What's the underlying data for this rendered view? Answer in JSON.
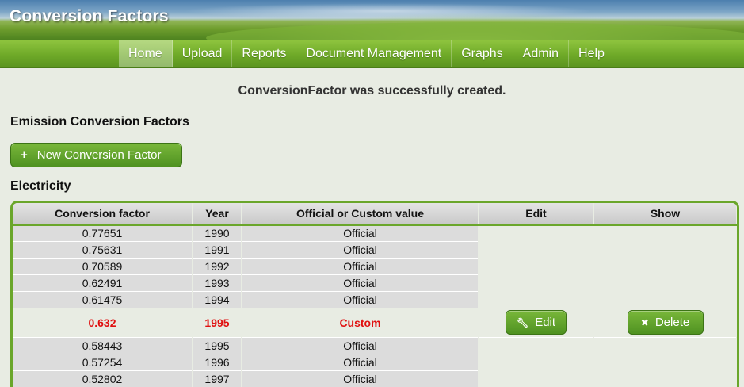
{
  "app": {
    "title": "Conversion Factors"
  },
  "nav": {
    "items": [
      {
        "label": "Home"
      },
      {
        "label": "Upload"
      },
      {
        "label": "Reports"
      },
      {
        "label": "Document Management"
      },
      {
        "label": "Graphs"
      },
      {
        "label": "Admin"
      },
      {
        "label": "Help"
      }
    ],
    "active": "Home"
  },
  "flash": "ConversionFactor was successfully created.",
  "section_title": "Emission Conversion Factors",
  "new_button": {
    "label": "New Conversion Factor",
    "icon": "plus-icon"
  },
  "group_title": "Electricity",
  "table": {
    "headers": [
      "Conversion factor",
      "Year",
      "Official or Custom value",
      "Edit",
      "Show"
    ],
    "rows_before": [
      {
        "factor": "0.77651",
        "year": "1990",
        "type": "Official"
      },
      {
        "factor": "0.75631",
        "year": "1991",
        "type": "Official"
      },
      {
        "factor": "0.70589",
        "year": "1992",
        "type": "Official"
      },
      {
        "factor": "0.62491",
        "year": "1993",
        "type": "Official"
      },
      {
        "factor": "0.61475",
        "year": "1994",
        "type": "Official"
      }
    ],
    "custom_row": {
      "factor": "0.632",
      "year": "1995",
      "type": "Custom",
      "edit_label": "Edit",
      "edit_icon": "wrench-icon",
      "delete_label": "Delete",
      "delete_icon": "x-icon",
      "color": "#e01010"
    },
    "rows_after": [
      {
        "factor": "0.58443",
        "year": "1995",
        "type": "Official"
      },
      {
        "factor": "0.57254",
        "year": "1996",
        "type": "Official"
      },
      {
        "factor": "0.52802",
        "year": "1997",
        "type": "Official"
      }
    ]
  },
  "colors": {
    "accent_green": "#6aa62b",
    "custom_red": "#e01010"
  }
}
